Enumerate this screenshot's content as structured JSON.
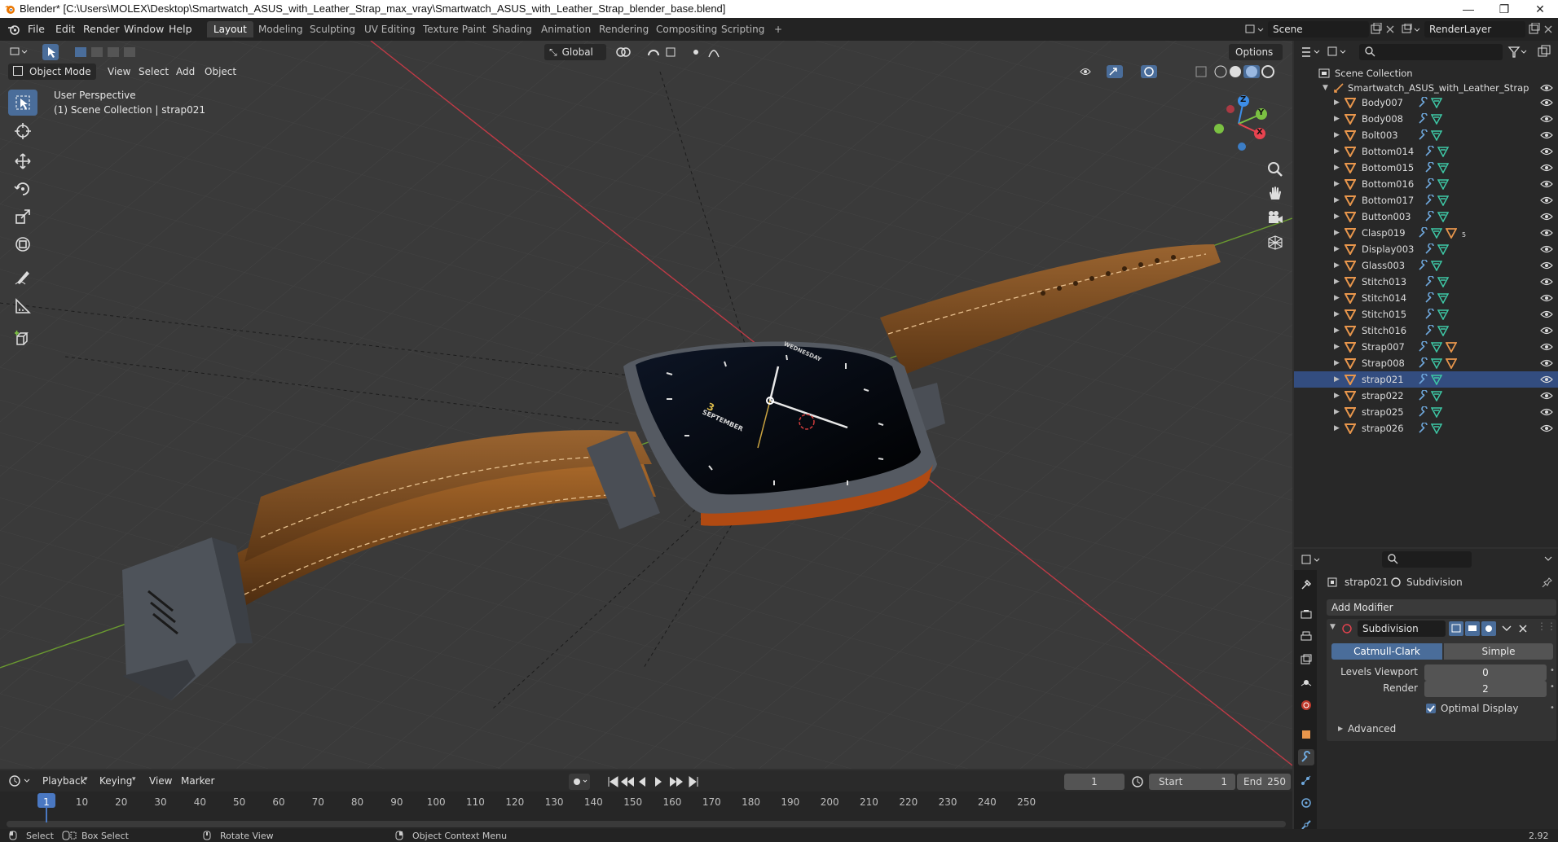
{
  "window": {
    "title": "Blender* [C:\\Users\\MOLEX\\Desktop\\Smartwatch_ASUS_with_Leather_Strap_max_vray\\Smartwatch_ASUS_with_Leather_Strap_blender_base.blend]",
    "minimize": "—",
    "maximize": "❐",
    "close": "✕"
  },
  "menu": {
    "items": [
      "File",
      "Edit",
      "Render",
      "Window",
      "Help"
    ],
    "workspaces": [
      "Layout",
      "Modeling",
      "Sculpting",
      "UV Editing",
      "Texture Paint",
      "Shading",
      "Animation",
      "Rendering",
      "Compositing",
      "Scripting"
    ],
    "active_workspace": "Layout",
    "add_tab": "+",
    "scene": "Scene",
    "view_layer": "RenderLayer"
  },
  "viewport_header": {
    "mode": "Object Mode",
    "menus": [
      "View",
      "Select",
      "Add",
      "Object"
    ],
    "orientation": "Global",
    "options": "Options"
  },
  "viewport": {
    "perspective": "User Perspective",
    "context": "(1) Scene Collection | strap021",
    "axes": {
      "x": "X",
      "y": "Y",
      "z": "Z"
    },
    "watch_face": {
      "date": "3",
      "month": "SEPTEMBER",
      "brand": "WEDNESDAY"
    }
  },
  "outliner": {
    "root": "Scene Collection",
    "collection": "Smartwatch_ASUS_with_Leather_Strap",
    "objects": [
      {
        "name": "Body007",
        "selected": false
      },
      {
        "name": "Body008",
        "selected": false
      },
      {
        "name": "Bolt003",
        "selected": false
      },
      {
        "name": "Bottom014",
        "selected": false
      },
      {
        "name": "Bottom015",
        "selected": false
      },
      {
        "name": "Bottom016",
        "selected": false
      },
      {
        "name": "Bottom017",
        "selected": false
      },
      {
        "name": "Button003",
        "selected": false
      },
      {
        "name": "Clasp019",
        "selected": false,
        "badge": "5"
      },
      {
        "name": "Display003",
        "selected": false
      },
      {
        "name": "Glass003",
        "selected": false
      },
      {
        "name": "Stitch013",
        "selected": false
      },
      {
        "name": "Stitch014",
        "selected": false
      },
      {
        "name": "Stitch015",
        "selected": false
      },
      {
        "name": "Stitch016",
        "selected": false
      },
      {
        "name": "Strap007",
        "selected": false
      },
      {
        "name": "Strap008",
        "selected": false
      },
      {
        "name": "strap021",
        "selected": true
      },
      {
        "name": "strap022",
        "selected": false
      },
      {
        "name": "strap025",
        "selected": false
      },
      {
        "name": "strap026",
        "selected": false
      }
    ]
  },
  "properties": {
    "object": "strap021",
    "modifier_crumb": "Subdivision",
    "add_modifier": "Add Modifier",
    "modifier": {
      "name": "Subdivision",
      "types": [
        "Catmull-Clark",
        "Simple"
      ],
      "active_type": "Catmull-Clark",
      "levels_viewport_label": "Levels Viewport",
      "levels_viewport": "0",
      "render_label": "Render",
      "render": "2",
      "optimal_display": "Optimal Display",
      "advanced": "Advanced"
    }
  },
  "timeline": {
    "menus": [
      "Playback",
      "Keying",
      "View",
      "Marker"
    ],
    "current_frame": "1",
    "start_label": "Start",
    "start": "1",
    "end_label": "End",
    "end": "250",
    "ticks": [
      "1",
      "10",
      "20",
      "30",
      "40",
      "50",
      "60",
      "70",
      "80",
      "90",
      "100",
      "110",
      "120",
      "130",
      "140",
      "150",
      "160",
      "170",
      "180",
      "190",
      "200",
      "210",
      "220",
      "230",
      "240",
      "250"
    ]
  },
  "status": {
    "select": "Select",
    "box_select": "Box Select",
    "rotate_view": "Rotate View",
    "context_menu": "Object Context Menu",
    "version": "2.92"
  },
  "colors": {
    "accent": "#4a6d9a",
    "selected_row": "#334d80",
    "object_icon": "#e8964c",
    "modifier_icon": "#6fa8dc",
    "mesh_icon": "#3ec8a6",
    "axis_x": "#e8434f",
    "axis_y": "#7bc142",
    "axis_z": "#3d8ee8"
  }
}
